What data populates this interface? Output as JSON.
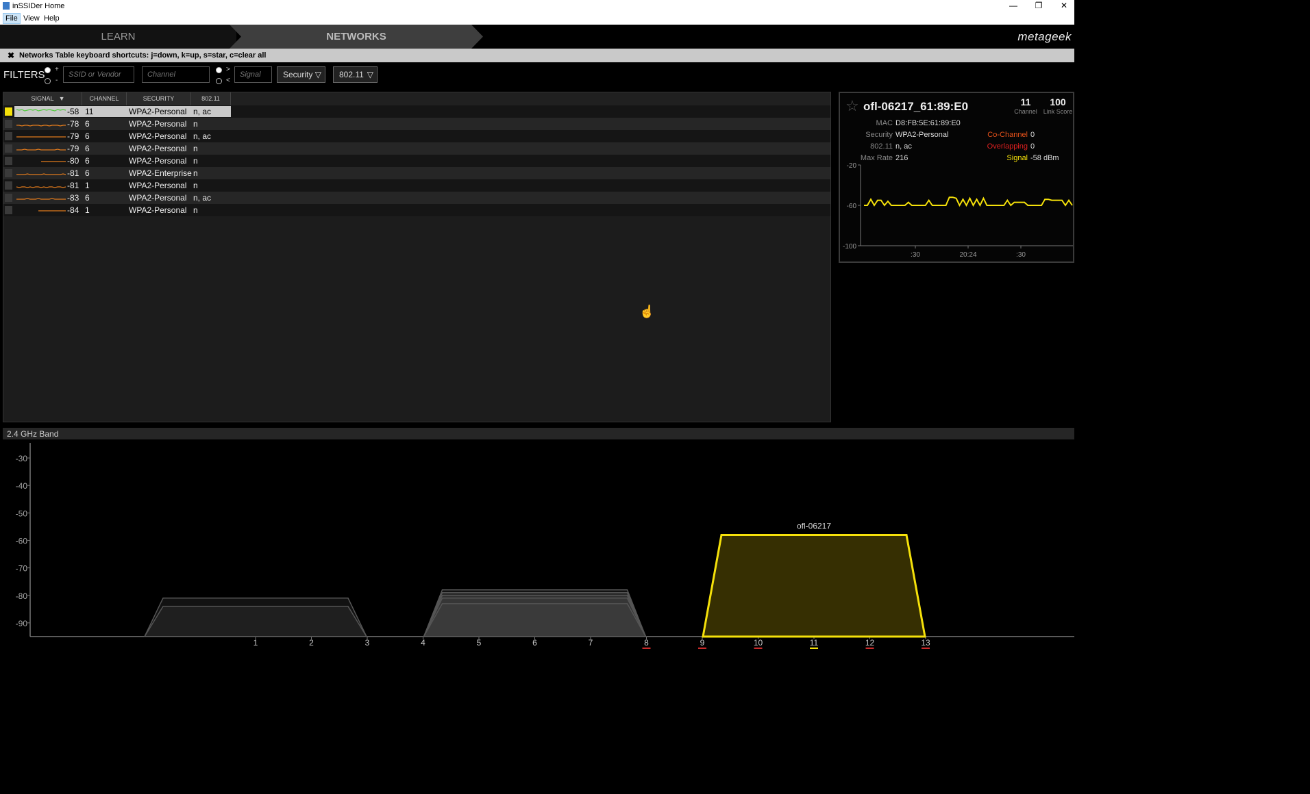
{
  "window": {
    "title": "inSSIDer Home",
    "minimize": "—",
    "restore": "❐",
    "close": "✕"
  },
  "menu": {
    "items": [
      "File",
      "View",
      "Help"
    ]
  },
  "tabs": {
    "learn": "LEARN",
    "networks": "NETWORKS"
  },
  "brand": "metageek",
  "shortcut_bar": {
    "close": "✖",
    "text": "Networks Table keyboard shortcuts: j=down, k=up, s=star, c=clear all"
  },
  "filters": {
    "label": "FILTERS",
    "plus": "+",
    "minus": "-",
    "gt": ">",
    "lt": "<",
    "ssid_placeholder": "SSID or Vendor",
    "channel_placeholder": "Channel",
    "signal_placeholder": "Signal",
    "security_label": "Security",
    "protocol_label": "802.11",
    "dropdown_arrow": "▽"
  },
  "table": {
    "columns": [
      "SIGNAL",
      "CHANNEL",
      "SECURITY",
      "802.11"
    ],
    "sort_arrow": "▼",
    "rows": [
      {
        "signal": "-58",
        "channel": "11",
        "security": "WPA2-Personal",
        "protocol": "n, ac",
        "starred": true,
        "color": "#4fc93a"
      },
      {
        "signal": "-78",
        "channel": "6",
        "security": "WPA2-Personal",
        "protocol": "n",
        "starred": false,
        "color": "#e07a1c"
      },
      {
        "signal": "-79",
        "channel": "6",
        "security": "WPA2-Personal",
        "protocol": "n, ac",
        "starred": false,
        "color": "#e07a1c"
      },
      {
        "signal": "-79",
        "channel": "6",
        "security": "WPA2-Personal",
        "protocol": "n",
        "starred": false,
        "color": "#e07a1c"
      },
      {
        "signal": "-80",
        "channel": "6",
        "security": "WPA2-Personal",
        "protocol": "n",
        "starred": false,
        "color": "#e07a1c"
      },
      {
        "signal": "-81",
        "channel": "6",
        "security": "WPA2-Enterprise",
        "protocol": "n",
        "starred": false,
        "color": "#e07a1c"
      },
      {
        "signal": "-81",
        "channel": "1",
        "security": "WPA2-Personal",
        "protocol": "n",
        "starred": false,
        "color": "#e07a1c"
      },
      {
        "signal": "-83",
        "channel": "6",
        "security": "WPA2-Personal",
        "protocol": "n, ac",
        "starred": false,
        "color": "#e07a1c"
      },
      {
        "signal": "-84",
        "channel": "1",
        "security": "WPA2-Personal",
        "protocol": "n",
        "starred": false,
        "color": "#e07a1c"
      }
    ]
  },
  "detail": {
    "star": "☆",
    "ssid": "ofl-06217_61:89:E0",
    "channel_value": "11",
    "channel_label": "Channel",
    "link_score_value": "100",
    "link_score_label": "Link Score",
    "mac_label": "MAC",
    "mac_value": "D8:FB:5E:61:89:E0",
    "security_label": "Security",
    "security_value": "WPA2-Personal",
    "protocol_label": "802.11",
    "protocol_value": "n, ac",
    "max_rate_label": "Max Rate",
    "max_rate_value": "216",
    "co_channel_label": "Co-Channel",
    "co_channel_value": "0",
    "overlapping_label": "Overlapping",
    "overlapping_value": "0",
    "signal_label": "Signal",
    "signal_value": "-58 dBm",
    "colors": {
      "co_channel": "#e8521a",
      "overlapping": "#e02020",
      "signal": "#f5e10a"
    }
  },
  "band_header": "2.4 GHz Band",
  "chart_data": [
    {
      "type": "line",
      "y_ticks": [
        "-20",
        "-60",
        "-100"
      ],
      "ylim": [
        -100,
        -20
      ],
      "x_ticks": [
        ":30",
        "20:24",
        ":30"
      ],
      "series": [
        {
          "color": "#f5e10a",
          "values": [
            -60,
            -60,
            -54,
            -60,
            -55,
            -55,
            -60,
            -56,
            -60,
            -60,
            -60,
            -60,
            -60,
            -57,
            -60,
            -60,
            -60,
            -60,
            -60,
            -55,
            -60,
            -60,
            -60,
            -60,
            -60,
            -52,
            -52,
            -53,
            -60,
            -54,
            -60,
            -53,
            -60,
            -54,
            -60,
            -53,
            -60,
            -60,
            -60,
            -60,
            -60,
            -60,
            -55,
            -60,
            -57,
            -57,
            -57,
            -57,
            -60,
            -60,
            -60,
            -60,
            -60,
            -54,
            -54,
            -55,
            -55,
            -55,
            -55,
            -60,
            -55,
            -60
          ]
        }
      ]
    },
    {
      "type": "area",
      "y_ticks": [
        "-30",
        "-40",
        "-50",
        "-60",
        "-70",
        "-80",
        "-90"
      ],
      "ylim": [
        -95,
        -25
      ],
      "x_ticks": [
        "1",
        "2",
        "3",
        "4",
        "5",
        "6",
        "7",
        "8",
        "9",
        "10",
        "11",
        "12",
        "13"
      ],
      "x_tick_underline": {
        "8": "#c92a2a",
        "9": "#c92a2a",
        "10": "#c92a2a",
        "11": "#f5e10a",
        "12": "#c92a2a",
        "13": "#c92a2a"
      },
      "series": [
        {
          "channel": 1,
          "signal": -81,
          "color": "#555555"
        },
        {
          "channel": 1,
          "signal": -84,
          "color": "#555555"
        },
        {
          "channel": 6,
          "signal": -78,
          "color": "#555555"
        },
        {
          "channel": 6,
          "signal": -79,
          "color": "#555555"
        },
        {
          "channel": 6,
          "signal": -79,
          "color": "#555555"
        },
        {
          "channel": 6,
          "signal": -80,
          "color": "#555555"
        },
        {
          "channel": 6,
          "signal": -81,
          "color": "#555555"
        },
        {
          "channel": 6,
          "signal": -83,
          "color": "#555555"
        },
        {
          "channel": 11,
          "signal": -58,
          "color": "#f5e10a",
          "label": "ofl-06217"
        }
      ]
    }
  ]
}
